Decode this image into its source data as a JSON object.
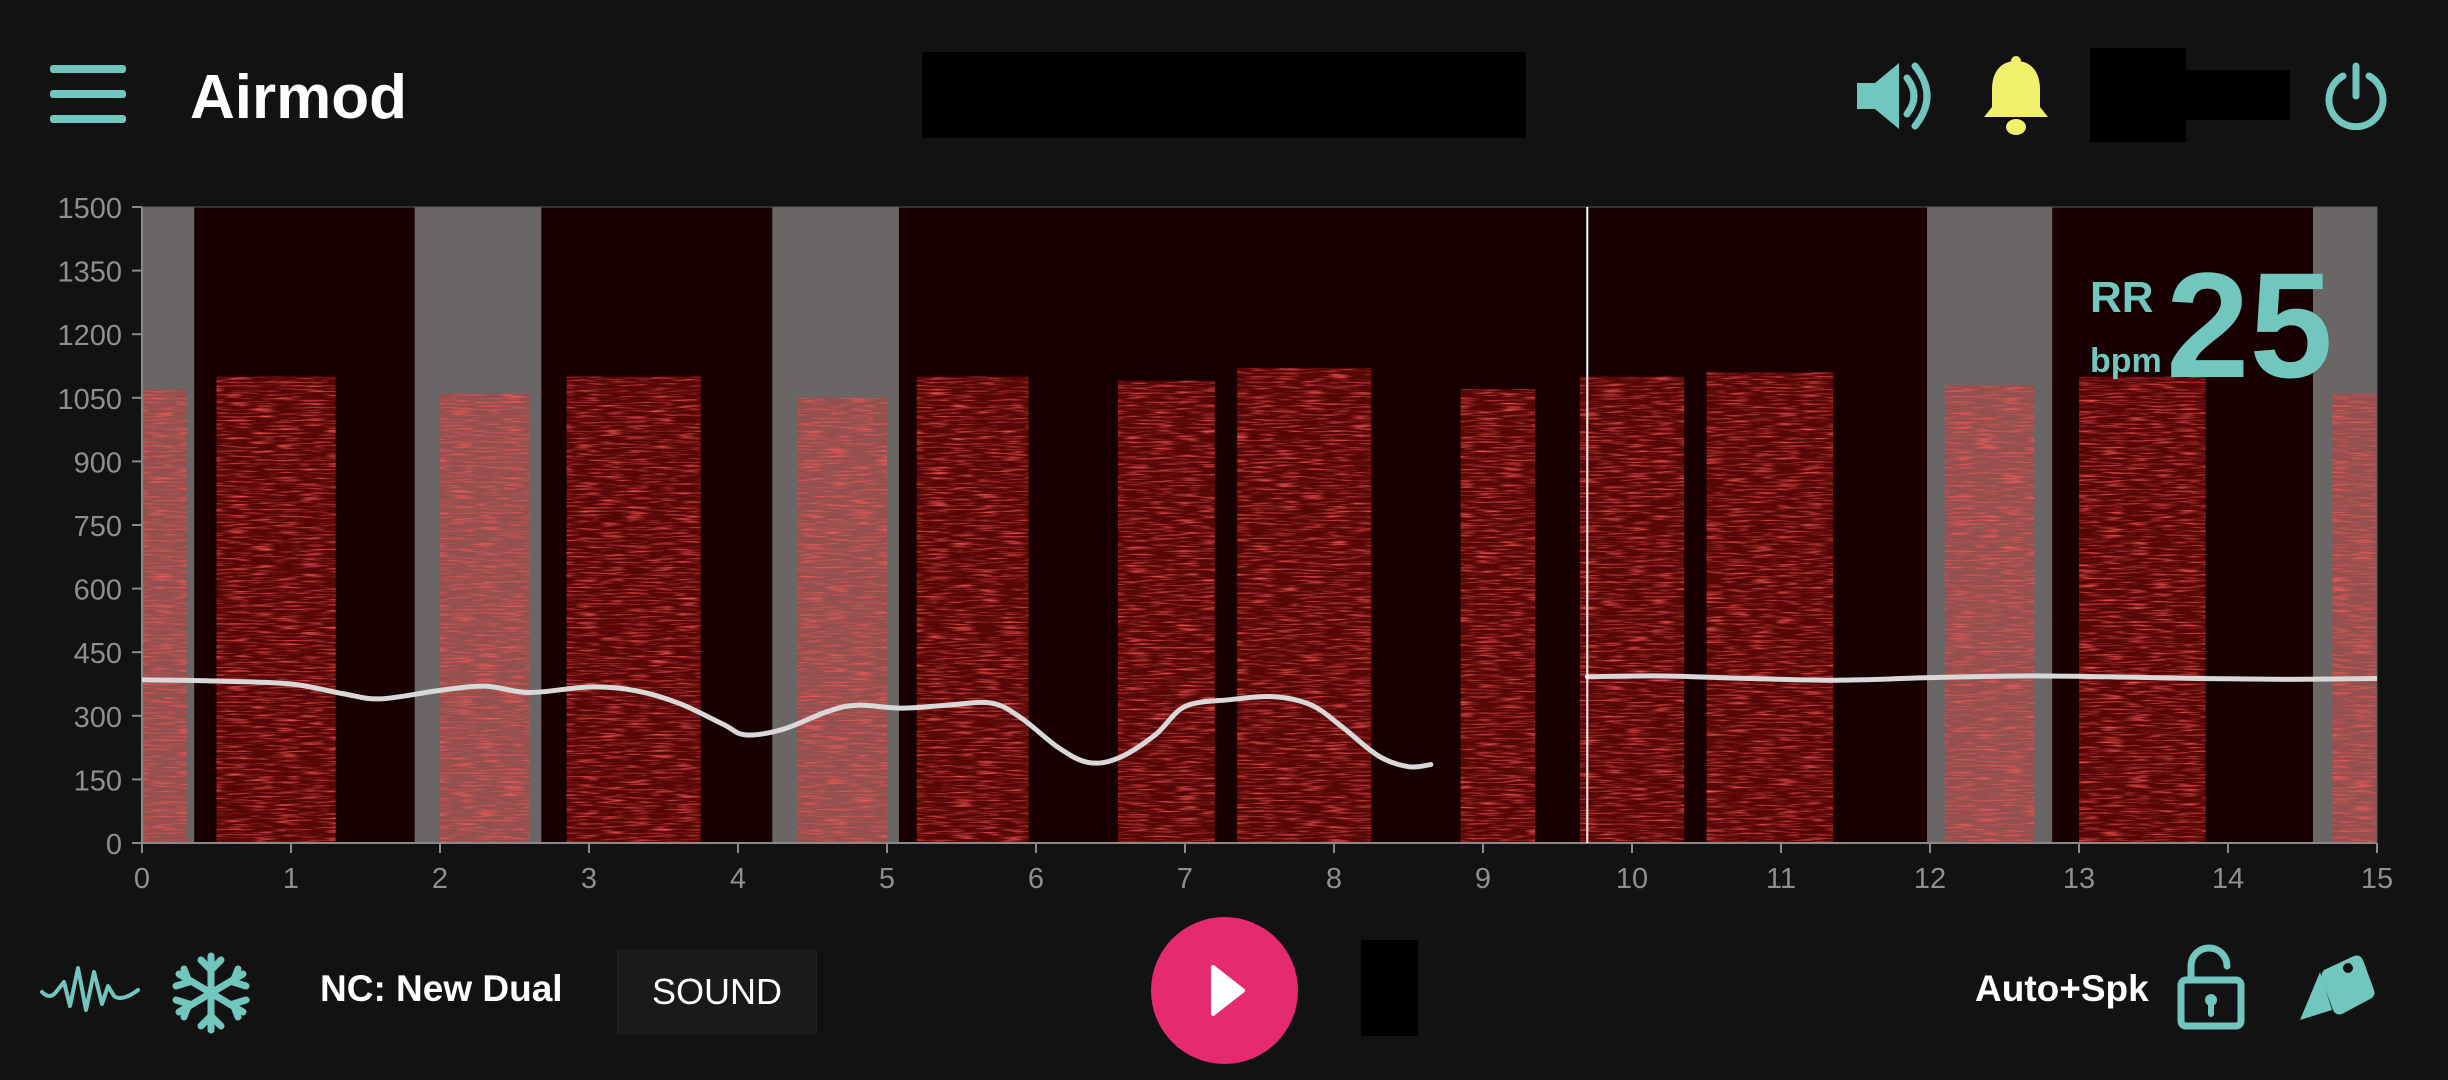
{
  "app": {
    "title": "Airmod"
  },
  "colors": {
    "accent": "#71c6bd",
    "bell": "#f0f06a",
    "play": "#e52a6f",
    "spectrogram": "#ff1a1a",
    "breath_band": "#6a6665",
    "waveform": "#d8d8d8"
  },
  "topbar": {
    "icons": [
      "menu-icon",
      "speaker-icon",
      "bell-icon",
      "power-icon"
    ]
  },
  "rr": {
    "label": "RR",
    "unit": "bpm",
    "value": "25"
  },
  "chart_data": {
    "type": "heatmap",
    "title": "",
    "xlabel": "",
    "ylabel": "",
    "xlim": [
      0,
      15
    ],
    "ylim": [
      0,
      1500
    ],
    "x_ticks": [
      "0",
      "1",
      "2",
      "3",
      "4",
      "5",
      "6",
      "7",
      "8",
      "9",
      "10",
      "11",
      "12",
      "13",
      "14",
      "15"
    ],
    "y_ticks": [
      "0",
      "150",
      "300",
      "450",
      "600",
      "750",
      "900",
      "1050",
      "1200",
      "1350",
      "1500"
    ],
    "cursor_x": 9.7,
    "grey_bands": [
      [
        0,
        0.35
      ],
      [
        1.83,
        2.68
      ],
      [
        4.23,
        5.08
      ],
      [
        11.98,
        12.82
      ],
      [
        14.57,
        15
      ]
    ],
    "energy_bursts": [
      [
        0.0,
        0.3,
        1070
      ],
      [
        0.5,
        1.3,
        1100
      ],
      [
        2.0,
        2.6,
        1060
      ],
      [
        2.85,
        3.75,
        1100
      ],
      [
        4.4,
        5.0,
        1050
      ],
      [
        5.2,
        5.95,
        1100
      ],
      [
        6.55,
        7.2,
        1090
      ],
      [
        7.35,
        8.25,
        1120
      ],
      [
        8.85,
        9.35,
        1070
      ],
      [
        9.65,
        10.35,
        1100
      ],
      [
        10.5,
        11.35,
        1110
      ],
      [
        12.1,
        12.7,
        1080
      ],
      [
        13.0,
        13.85,
        1100
      ],
      [
        14.7,
        15.0,
        1060
      ]
    ],
    "waveform_left": [
      [
        0.0,
        385
      ],
      [
        0.5,
        382
      ],
      [
        1.0,
        375
      ],
      [
        1.35,
        352
      ],
      [
        1.6,
        340
      ],
      [
        2.0,
        360
      ],
      [
        2.3,
        370
      ],
      [
        2.6,
        355
      ],
      [
        3.0,
        368
      ],
      [
        3.3,
        360
      ],
      [
        3.6,
        330
      ],
      [
        3.9,
        280
      ],
      [
        4.05,
        255
      ],
      [
        4.3,
        268
      ],
      [
        4.6,
        310
      ],
      [
        4.8,
        325
      ],
      [
        5.1,
        318
      ],
      [
        5.4,
        325
      ],
      [
        5.7,
        330
      ],
      [
        5.9,
        295
      ],
      [
        6.15,
        225
      ],
      [
        6.35,
        190
      ],
      [
        6.55,
        200
      ],
      [
        6.8,
        255
      ],
      [
        7.0,
        322
      ],
      [
        7.3,
        338
      ],
      [
        7.6,
        345
      ],
      [
        7.85,
        325
      ],
      [
        8.05,
        275
      ],
      [
        8.3,
        205
      ],
      [
        8.5,
        180
      ],
      [
        8.65,
        185
      ]
    ],
    "waveform_right": [
      [
        9.7,
        392
      ],
      [
        10.2,
        394
      ],
      [
        10.8,
        388
      ],
      [
        11.4,
        384
      ],
      [
        12.0,
        390
      ],
      [
        12.6,
        394
      ],
      [
        13.2,
        392
      ],
      [
        13.8,
        388
      ],
      [
        14.4,
        386
      ],
      [
        15.0,
        388
      ]
    ]
  },
  "bottombar": {
    "nc_label": "NC: New Dual",
    "sound_button": "SOUND",
    "mode_label": "Auto+Spk",
    "icons": [
      "waveform-icon",
      "snowflake-icon",
      "play-icon",
      "lock-icon",
      "tags-icon"
    ]
  }
}
